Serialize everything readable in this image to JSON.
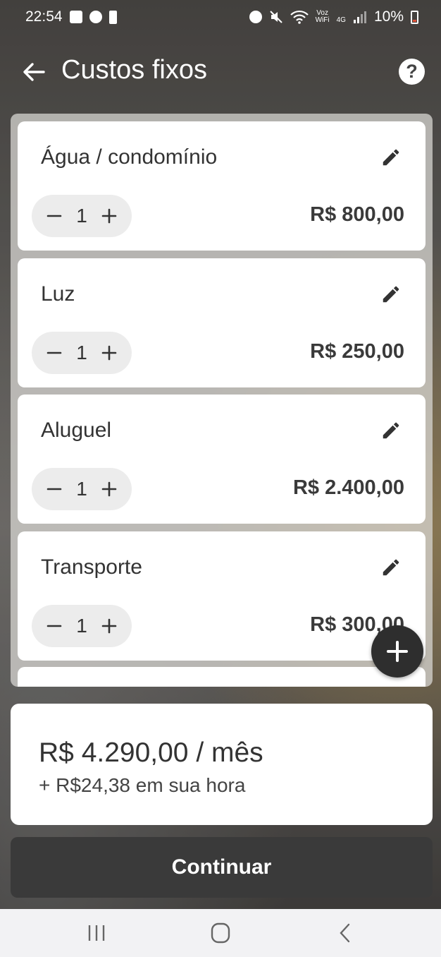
{
  "status_bar": {
    "time": "22:54",
    "network_small_top": "Voz",
    "network_small_bottom": "WiFi",
    "network_type": "4G",
    "battery": "10%"
  },
  "header": {
    "title": "Custos fixos",
    "help_label": "?"
  },
  "items": [
    {
      "name": "Água / condomínio",
      "quantity": "1",
      "amount": "R$ 800,00"
    },
    {
      "name": "Luz",
      "quantity": "1",
      "amount": "R$ 250,00"
    },
    {
      "name": "Aluguel",
      "quantity": "1",
      "amount": "R$ 2.400,00"
    },
    {
      "name": "Transporte",
      "quantity": "1",
      "amount": "R$ 300,00"
    }
  ],
  "totals": {
    "per_month": "R$ 4.290,00 / mês",
    "per_hour": "+ R$24,38 em sua hora"
  },
  "continue_label": "Continuar",
  "icons": {
    "back": "arrow-left-icon",
    "help": "help-circle-icon",
    "edit": "pencil-icon",
    "minus": "minus-icon",
    "plus": "plus-icon",
    "add": "add-icon"
  }
}
